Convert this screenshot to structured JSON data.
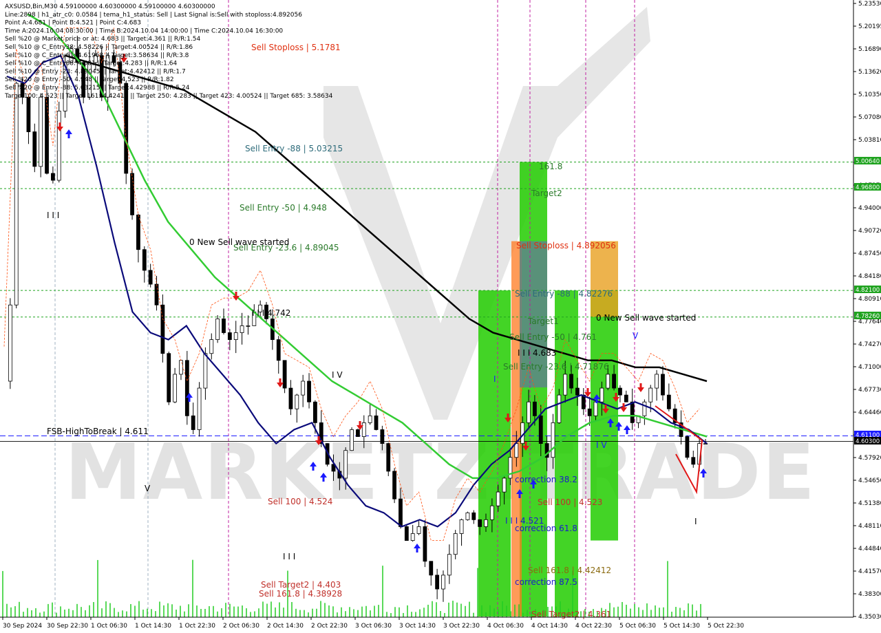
{
  "header": {
    "lines": [
      "AXSUSD,Bin,M30  4.59100000 4.60300000 4.59100000 4.60300000",
      "Line:2898  | h1_atr_c0: 0.0584  | tema_h1_status: Sell  | Last Signal is:Sell with stoploss:4.892056",
      "Point A:4.681  | Point B:4.521  | Point C:4.683",
      "Time A:2024.10.04 08:30:00  | Time B:2024.10.04 14:00:00  | Time C:2024.10.04 16:30:00",
      "Sell %20 @ Market price or at: 4.683  || Target:4.361  || R/R:1.54",
      "Sell %10 @ C_Entry38: 4.58226  || Target:4.00524  || R/R:1.86",
      "Sell %10 @ C_Entry61: 4.61968  || Target:3.58634  || R/R:3.8",
      "Sell %10 @ C_Entry88: 4.681  || Target:4.283  || R/R:1.64",
      "Sell %10 @ Entry -23: 4.89045  || Target:4.42412  || R/R:1.7",
      "Sell %20 @ Entry -50: 4.948  || Target:4.523  || R/R:1.82",
      "Sell %20 @ Entry -88: 5.03215  || Target:4.42988  || R/R:5.24",
      "Target100: 4.523  || Target 161: 4.42412  || Target 250: 4.283  || Target 423: 4.00524  || Target 685: 3.58634"
    ]
  },
  "y_axis": {
    "ticks": [
      "5.23530",
      "5.20195",
      "5.16890",
      "5.13620",
      "5.10350",
      "5.07080",
      "5.03810",
      "5.00640",
      "4.97370",
      "4.94000",
      "4.90720",
      "4.87450",
      "4.84180",
      "4.80910",
      "4.77640",
      "4.74270",
      "4.71000",
      "4.67730",
      "4.64460",
      "4.61190",
      "4.57920",
      "4.54650",
      "4.51380",
      "4.48110",
      "4.44840",
      "4.41570",
      "4.38300",
      "4.35030"
    ]
  },
  "x_axis": {
    "ticks": [
      "30 Sep 2024",
      "30 Sep 22:30",
      "1 Oct 06:30",
      "1 Oct 14:30",
      "1 Oct 22:30",
      "2 Oct 06:30",
      "2 Oct 14:30",
      "2 Oct 22:30",
      "3 Oct 06:30",
      "3 Oct 14:30",
      "3 Oct 22:30",
      "4 Oct 06:30",
      "4 Oct 14:30",
      "4 Oct 22:30",
      "5 Oct 06:30",
      "5 Oct 14:30",
      "5 Oct 22:30"
    ]
  },
  "price_labels": [
    {
      "text": "5.00640",
      "color": "#1fa31f"
    },
    {
      "text": "4.96800",
      "color": "#1fa31f"
    },
    {
      "text": "4.82100",
      "color": "#1fa31f"
    },
    {
      "text": "4.78260",
      "color": "#1fa31f"
    },
    {
      "text": "4.61100",
      "color": "#1a1aff"
    },
    {
      "text": "4.60300",
      "color": "#000000"
    }
  ],
  "annotations": [
    {
      "text": "Sell Stoploss | 5.1781",
      "color": "#e03010"
    },
    {
      "text": "Sell Entry -88 | 5.03215",
      "color": "#2d6b7a"
    },
    {
      "text": "Sell Entry -50 | 4.948",
      "color": "#2a7a2a"
    },
    {
      "text": "Sell Entry -23.6 | 4.89045",
      "color": "#2a7a2a"
    },
    {
      "text": "0 New Sell wave started",
      "color": "#000000"
    },
    {
      "text": "I I I 4.742",
      "color": "#000000"
    },
    {
      "text": "I V",
      "color": "#000000"
    },
    {
      "text": "I I I",
      "color": "#000000"
    },
    {
      "text": "V",
      "color": "#000000"
    },
    {
      "text": "FSB-HighToBreak | 4.611",
      "color": "#000000"
    },
    {
      "text": "Sell 100 | 4.524",
      "color": "#c0302a"
    },
    {
      "text": "I I I",
      "color": "#000000"
    },
    {
      "text": "Sell Target2 | 4.403",
      "color": "#c0302a"
    },
    {
      "text": "Sell 161.8 | 4.38928",
      "color": "#c0302a"
    },
    {
      "text": "161.8",
      "color": "#2a7a2a"
    },
    {
      "text": "Target2",
      "color": "#2a7a2a"
    },
    {
      "text": "Sell Stoploss | 4.892056",
      "color": "#e03010"
    },
    {
      "text": "Sell Entry -88 | 4.82276",
      "color": "#2d6b7a"
    },
    {
      "text": "Target1",
      "color": "#2a7a2a"
    },
    {
      "text": "0 New Sell wave started",
      "color": "#000000"
    },
    {
      "text": "Sell Entry -50 | 4.761",
      "color": "#2a7a2a"
    },
    {
      "text": "I I I 4.683",
      "color": "#000000"
    },
    {
      "text": "Sell Entry -23.6 | 4.71876",
      "color": "#2a7a2a"
    },
    {
      "text": "I",
      "color": "#1a1aff"
    },
    {
      "text": "V",
      "color": "#1a1aff"
    },
    {
      "text": "I V",
      "color": "#1a1aff"
    },
    {
      "text": "correction 38.2",
      "color": "#1a1acc"
    },
    {
      "text": "Sell 100 | 4.523",
      "color": "#c0302a"
    },
    {
      "text": "I I I 4.521",
      "color": "#1a1acc"
    },
    {
      "text": "correction 61.8",
      "color": "#1a1acc"
    },
    {
      "text": "Sell 161.8 | 4.42412",
      "color": "#8a6a10"
    },
    {
      "text": "correction 87.5",
      "color": "#1a1acc"
    },
    {
      "text": "Sell Target2 | 4.361",
      "color": "#c0302a"
    },
    {
      "text": "I",
      "color": "#000000"
    }
  ],
  "watermark": "MARKETZITRADE",
  "chart_data": {
    "type": "candlestick",
    "symbol": "AXSUSD",
    "timeframe": "M30",
    "ylim": [
      4.3503,
      5.2353
    ],
    "hlines": [
      {
        "value": 5.0064,
        "color": "#1fa31f",
        "style": "dotted"
      },
      {
        "value": 4.968,
        "color": "#1fa31f",
        "style": "dotted"
      },
      {
        "value": 4.821,
        "color": "#1fa31f",
        "style": "dotted"
      },
      {
        "value": 4.7826,
        "color": "#1fa31f",
        "style": "dotted"
      },
      {
        "value": 4.611,
        "color": "#1a1aff",
        "style": "dashed"
      },
      {
        "value": 4.603,
        "color": "#000000",
        "style": "solid"
      }
    ],
    "zones": [
      {
        "color": "#22cc00",
        "low": 4.3503,
        "high": 4.821
      },
      {
        "color": "#22cc00",
        "low": 4.3503,
        "high": 5.0064
      },
      {
        "color": "#ff7a20",
        "low": 4.3503,
        "high": 4.8921
      },
      {
        "color": "#22cc00",
        "low": 4.3503,
        "high": 4.821
      },
      {
        "color": "#22cc00",
        "low": 4.46,
        "high": 4.821
      },
      {
        "color": "#e8a020",
        "low": 4.7826,
        "high": 4.8921
      }
    ],
    "price_series": [
      4.69,
      4.8,
      5.12,
      5.1,
      5.05,
      5.0,
      5.1,
      4.99,
      4.98,
      5.08,
      5.15,
      5.17,
      5.15,
      5.1,
      5.15,
      5.16,
      5.1,
      5.16,
      5.15,
      5.12,
      4.99,
      4.93,
      4.88,
      4.85,
      4.83,
      4.8,
      4.73,
      4.66,
      4.7,
      4.72,
      4.64,
      4.62,
      4.68,
      4.73,
      4.75,
      4.78,
      4.76,
      4.75,
      4.76,
      4.77,
      4.77,
      4.79,
      4.8,
      4.78,
      4.75,
      4.72,
      4.68,
      4.65,
      4.67,
      4.69,
      4.66,
      4.63,
      4.6,
      4.57,
      4.56,
      4.55,
      4.59,
      4.62,
      4.61,
      4.63,
      4.64,
      4.62,
      4.6,
      4.56,
      4.52,
      4.48,
      4.46,
      4.47,
      4.48,
      4.43,
      4.41,
      4.39,
      4.41,
      4.44,
      4.47,
      4.49,
      4.5,
      4.49,
      4.48,
      4.49,
      4.51,
      4.53,
      4.55,
      4.58,
      4.6,
      4.63,
      4.66,
      4.64,
      4.6,
      4.58,
      4.63,
      4.67,
      4.7,
      4.68,
      4.67,
      4.65,
      4.64,
      4.66,
      4.68,
      4.7,
      4.68,
      4.67,
      4.66,
      4.63,
      4.64,
      4.66,
      4.68,
      4.7,
      4.67,
      4.65,
      4.63,
      4.61,
      4.58,
      4.57,
      4.6,
      4.6
    ],
    "lines": [
      {
        "name": "black",
        "color": "#000000",
        "values": [
          5.16,
          5.15,
          5.14,
          5.13,
          5.12,
          5.11,
          5.09,
          5.07,
          5.05,
          5.02,
          4.99,
          4.96,
          4.93,
          4.9,
          4.87,
          4.84,
          4.81,
          4.78,
          4.76,
          4.75,
          4.74,
          4.73,
          4.72,
          4.72,
          4.71,
          4.71,
          4.7,
          4.69
        ]
      },
      {
        "name": "green",
        "color": "#33cc33",
        "values": [
          5.22,
          5.2,
          5.16,
          5.12,
          5.05,
          4.98,
          4.92,
          4.88,
          4.84,
          4.81,
          4.78,
          4.75,
          4.72,
          4.69,
          4.67,
          4.65,
          4.63,
          4.6,
          4.57,
          4.55,
          4.55,
          4.56,
          4.58,
          4.61,
          4.63,
          4.64,
          4.64,
          4.63,
          4.62,
          4.61
        ]
      },
      {
        "name": "navy",
        "color": "#0a0a7a",
        "values": [
          5.13,
          5.12,
          5.15,
          5.16,
          5.1,
          5.0,
          4.89,
          4.79,
          4.76,
          4.75,
          4.77,
          4.73,
          4.7,
          4.67,
          4.63,
          4.6,
          4.62,
          4.63,
          4.58,
          4.54,
          4.51,
          4.5,
          4.48,
          4.49,
          4.48,
          4.5,
          4.54,
          4.57,
          4.59,
          4.62,
          4.65,
          4.66,
          4.67,
          4.66,
          4.65,
          4.66,
          4.65,
          4.63,
          4.62,
          4.6
        ]
      }
    ]
  }
}
